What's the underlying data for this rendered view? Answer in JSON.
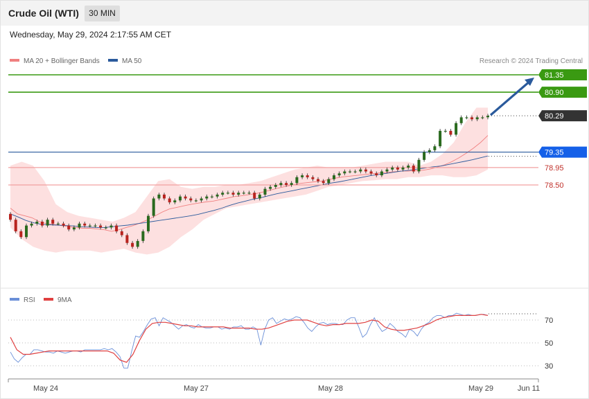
{
  "header": {
    "title": "Crude Oil (WTI)",
    "interval": "30 MIN"
  },
  "timestamp": "Wednesday, May 29, 2024 2:17:55 AM CET",
  "legend": {
    "ma20": "MA 20 + Bollinger Bands",
    "ma50": "MA 50",
    "rsi": "RSI",
    "rsi_ma": "9MA",
    "credit": "Research © 2024 Trading Central"
  },
  "colors": {
    "ma20": "#f08080",
    "ma50": "#2a5a9c",
    "bollinger_fill": "#fde0e0",
    "resistance": "#3a9a12",
    "support": "#f2a0a0",
    "pivot": "#2a5a9c",
    "pivot_label": "#1560e8",
    "current_label": "#333333",
    "arrow": "#2a5a9c",
    "candle_up": "#2a6a1e",
    "candle_down": "#b8231e",
    "rsi": "#6a8fd8",
    "rsi_ma": "#e04040"
  },
  "chart_data": [
    {
      "type": "candlestick",
      "title": "Crude Oil (WTI)",
      "timeframe": "30 MIN",
      "x_labels": [
        "May 24",
        "May 27",
        "May 28",
        "May 29",
        "Jun 11"
      ],
      "ylim": [
        76.6,
        81.5
      ],
      "levels": [
        {
          "value": 81.35,
          "label": "81.35",
          "kind": "resistance"
        },
        {
          "value": 80.9,
          "label": "80.90",
          "kind": "resistance"
        },
        {
          "value": 80.29,
          "label": "80.29",
          "kind": "current"
        },
        {
          "value": 79.35,
          "label": "79.35",
          "kind": "pivot"
        },
        {
          "value": 78.95,
          "label": "78.95",
          "kind": "support"
        },
        {
          "value": 78.5,
          "label": "78.50",
          "kind": "support"
        }
      ],
      "forecast_arrow": {
        "from": 80.29,
        "to": 81.35
      },
      "close_series": [
        77.6,
        77.3,
        77.15,
        77.45,
        77.5,
        77.55,
        77.45,
        77.6,
        77.5,
        77.5,
        77.45,
        77.35,
        77.4,
        77.5,
        77.45,
        77.45,
        77.45,
        77.4,
        77.4,
        77.45,
        77.3,
        77.2,
        77.0,
        76.9,
        77.05,
        77.3,
        77.7,
        78.15,
        78.25,
        78.15,
        78.05,
        78.1,
        78.2,
        78.15,
        78.1,
        78.1,
        78.15,
        78.2,
        78.2,
        78.25,
        78.3,
        78.3,
        78.25,
        78.3,
        78.3,
        78.3,
        78.15,
        78.25,
        78.4,
        78.45,
        78.5,
        78.55,
        78.5,
        78.55,
        78.7,
        78.75,
        78.7,
        78.65,
        78.6,
        78.55,
        78.65,
        78.75,
        78.8,
        78.85,
        78.85,
        78.85,
        78.9,
        78.85,
        78.8,
        78.75,
        78.85,
        78.9,
        78.95,
        78.9,
        78.95,
        79.0,
        78.85,
        79.15,
        79.35,
        79.4,
        79.5,
        79.9,
        79.9,
        79.8,
        80.1,
        80.25,
        80.25,
        80.2,
        80.25,
        80.25,
        80.29
      ],
      "ma20_series": [
        77.9,
        77.75,
        77.7,
        77.65,
        77.55,
        77.5,
        77.48,
        77.45,
        77.42,
        77.4,
        77.38,
        77.38,
        77.36,
        77.34,
        77.3,
        77.34,
        77.4,
        77.45,
        77.52,
        77.6,
        77.7,
        77.8,
        77.88,
        77.92,
        77.96,
        78.0,
        78.03,
        78.06,
        78.08,
        78.12,
        78.16,
        78.2,
        78.22,
        78.25,
        78.28,
        78.32,
        78.37,
        78.42,
        78.46,
        78.5,
        78.54,
        78.56,
        78.58,
        78.6,
        78.64,
        78.68,
        78.71,
        78.73,
        78.75,
        78.77,
        78.79,
        78.81,
        78.82,
        78.84,
        78.86,
        78.86,
        78.87,
        78.88,
        78.91,
        78.96,
        79.02,
        79.1,
        79.2,
        79.32,
        79.45,
        79.6,
        79.78
      ],
      "ma50_series": [
        77.75,
        77.67,
        77.58,
        77.52,
        77.48,
        77.47,
        77.46,
        77.45,
        77.44,
        77.42,
        77.41,
        77.4,
        77.4,
        77.42,
        77.44,
        77.46,
        77.49,
        77.52,
        77.55,
        77.58,
        77.61,
        77.64,
        77.67,
        77.7,
        77.74,
        77.79,
        77.84,
        77.9,
        77.97,
        78.03,
        78.08,
        78.13,
        78.17,
        78.22,
        78.27,
        78.31,
        78.35,
        78.39,
        78.43,
        78.47,
        78.51,
        78.55,
        78.58,
        78.62,
        78.66,
        78.7,
        78.74,
        78.77,
        78.8,
        78.83,
        78.86,
        78.88,
        78.91,
        78.94,
        78.97,
        78.99,
        79.03,
        79.07,
        79.11,
        79.15,
        79.2,
        79.25
      ],
      "bollinger_upper": [
        79.0,
        79.1,
        79.0,
        78.6,
        78.0,
        77.8,
        77.7,
        77.65,
        77.6,
        77.55,
        77.65,
        77.8,
        78.2,
        78.6,
        78.65,
        78.45,
        78.4,
        78.45,
        78.45,
        78.5,
        78.5,
        78.55,
        78.6,
        78.7,
        78.8,
        78.9,
        78.95,
        79.0,
        78.95,
        78.95,
        78.95,
        79.0,
        79.05,
        79.1,
        79.1,
        79.1,
        79.0,
        79.1,
        79.3,
        79.6,
        80.1,
        80.5,
        80.5
      ],
      "bollinger_lower": [
        77.4,
        77.1,
        76.9,
        76.8,
        76.75,
        76.8,
        76.8,
        76.8,
        76.75,
        76.8,
        76.85,
        76.75,
        76.7,
        76.75,
        76.9,
        77.15,
        77.35,
        77.6,
        77.75,
        77.9,
        77.95,
        78.0,
        78.05,
        78.1,
        78.15,
        78.2,
        78.25,
        78.35,
        78.45,
        78.5,
        78.55,
        78.6,
        78.62,
        78.65,
        78.65,
        78.7,
        78.7,
        78.75,
        78.75,
        78.7,
        78.7,
        78.75,
        78.9
      ]
    },
    {
      "type": "line",
      "title": "RSI",
      "series": [
        {
          "name": "RSI",
          "values": [
            42,
            36,
            33,
            37,
            40,
            40,
            44,
            44,
            43,
            42,
            42,
            41,
            43,
            42,
            41,
            42,
            43,
            43,
            42,
            44,
            44,
            44,
            44,
            44,
            45,
            44,
            45,
            42,
            38,
            28,
            28,
            43,
            56,
            55,
            60,
            66,
            71,
            72,
            65,
            72,
            70,
            68,
            65,
            62,
            65,
            66,
            64,
            63,
            66,
            64,
            63,
            63,
            64,
            64,
            62,
            63,
            62,
            64,
            64,
            65,
            62,
            62,
            64,
            62,
            48,
            62,
            70,
            72,
            67,
            69,
            71,
            70,
            71,
            73,
            72,
            68,
            63,
            60,
            64,
            67,
            68,
            66,
            67,
            67,
            66,
            66,
            70,
            72,
            72,
            64,
            55,
            58,
            66,
            72,
            65,
            60,
            62,
            67,
            64,
            60,
            58,
            55,
            62,
            60,
            56,
            62,
            66,
            68,
            72,
            74,
            74,
            72,
            74,
            74,
            76,
            75,
            74,
            75,
            74,
            74,
            75,
            75,
            74
          ]
        },
        {
          "name": "9MA",
          "values": [
            55,
            44,
            40,
            40,
            41,
            42,
            43,
            43,
            43,
            43,
            43,
            43,
            43,
            43,
            43,
            43,
            41,
            35,
            33,
            40,
            52,
            62,
            67,
            68,
            68,
            67,
            66,
            65,
            65,
            64,
            64,
            64,
            64,
            64,
            63,
            63,
            63,
            63,
            62,
            62,
            63,
            65,
            67,
            69,
            70,
            70,
            70,
            68,
            66,
            65,
            66,
            66,
            67,
            67,
            67,
            68,
            70,
            69,
            64,
            62,
            61,
            61,
            62,
            63,
            65,
            67,
            70,
            72,
            73,
            74,
            74,
            74,
            74,
            75,
            74
          ]
        }
      ],
      "yticks": [
        30,
        50,
        70
      ],
      "ylim": [
        20,
        82
      ]
    }
  ]
}
